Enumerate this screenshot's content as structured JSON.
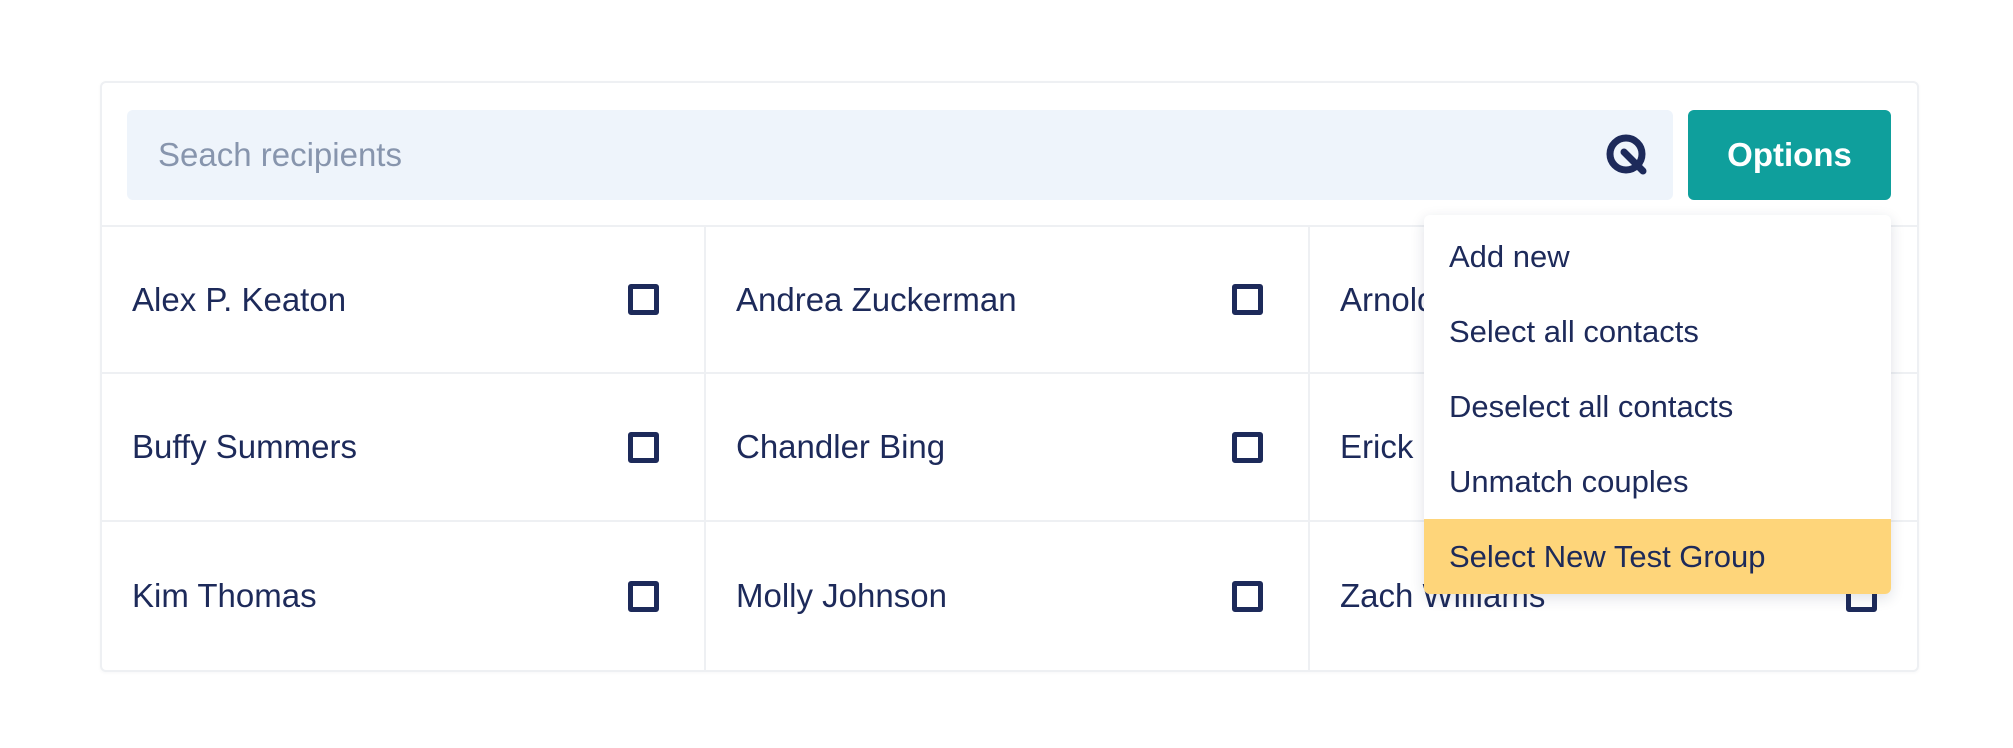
{
  "search": {
    "placeholder": "Seach recipients",
    "value": ""
  },
  "options_button": {
    "label": "Options"
  },
  "contacts": [
    {
      "name": "Alex P. Keaton",
      "checked": false
    },
    {
      "name": "Andrea Zuckerman",
      "checked": false
    },
    {
      "name": "Arnold Jackson",
      "checked": false
    },
    {
      "name": "Buffy Summers",
      "checked": false
    },
    {
      "name": "Chandler Bing",
      "checked": false
    },
    {
      "name": "Erick Matthews",
      "checked": false
    },
    {
      "name": "Kim Thomas",
      "checked": false
    },
    {
      "name": "Molly Johnson",
      "checked": false
    },
    {
      "name": "Zach Williams",
      "checked": false
    }
  ],
  "options_menu": {
    "open": true,
    "items": [
      {
        "label": "Add new"
      },
      {
        "label": "Select all contacts"
      },
      {
        "label": "Deselect all contacts"
      },
      {
        "label": "Unmatch couples"
      },
      {
        "label": "Select New Test Group",
        "highlighted": true
      }
    ]
  },
  "colors": {
    "accent": "#0f9f9c",
    "highlight": "#fed57a",
    "text": "#1d2a5a",
    "search_background": "#eef4fb",
    "placeholder": "#8795ad"
  },
  "icons": {
    "search": "search-icon"
  }
}
